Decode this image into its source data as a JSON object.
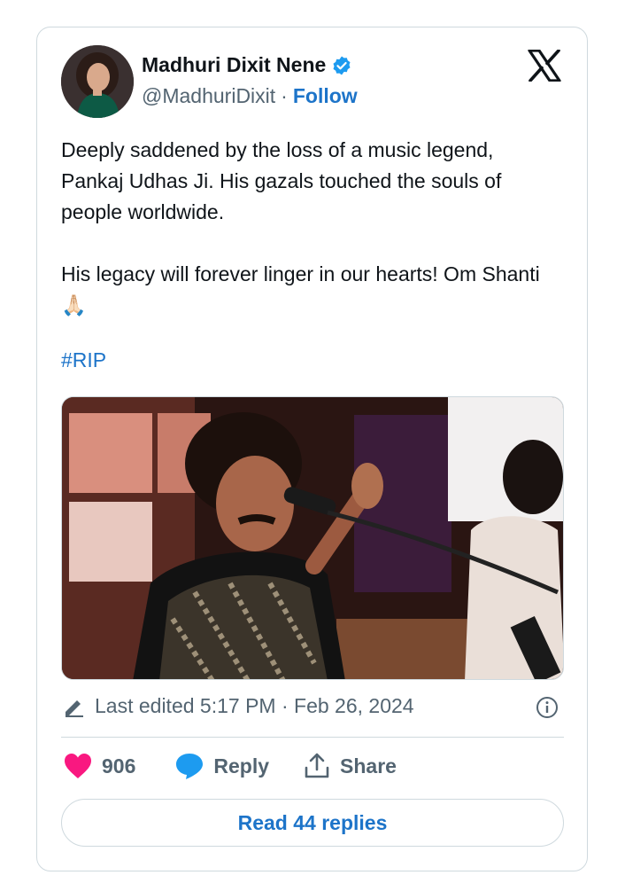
{
  "author": {
    "name": "Madhuri Dixit Nene",
    "handle": "@MadhuriDixit",
    "separator": "·",
    "follow_label": "Follow"
  },
  "tweet": {
    "text": "Deeply saddened by the loss of a music legend, Pankaj Udhas Ji. His gazals touched the souls of people worldwide.\n\nHis legacy will forever linger in our hearts! Om Shanti 🙏🏻",
    "hashtag": "#RIP"
  },
  "meta": {
    "edited": "Last edited 5:17 PM · Feb 26, 2024"
  },
  "actions": {
    "likes": "906",
    "reply_label": "Reply",
    "share_label": "Share"
  },
  "footer": {
    "read_replies_label": "Read 44 replies"
  },
  "colors": {
    "accent": "#1d74c9",
    "like": "#f91880",
    "reply_icon": "#1d9bf0",
    "muted": "#536471",
    "border": "#cfd9de"
  },
  "icons": [
    "verified-icon",
    "x-logo-icon",
    "edit-pencil-icon",
    "info-icon",
    "heart-icon",
    "reply-bubble-icon",
    "share-icon"
  ]
}
